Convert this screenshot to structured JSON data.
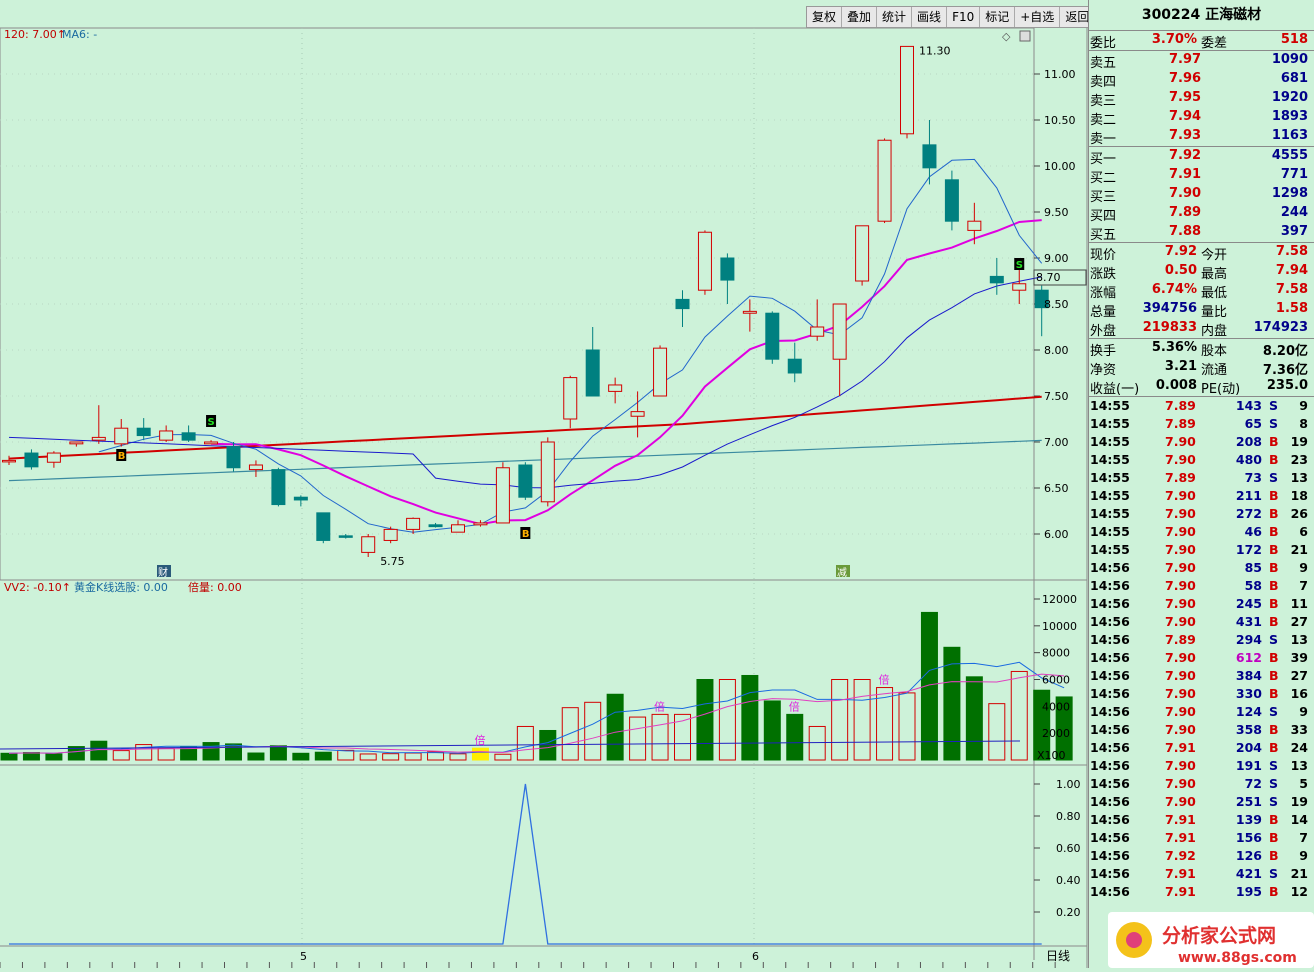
{
  "toolbar": {
    "buttons": [
      "复权",
      "叠加",
      "统计",
      "画线",
      "F10",
      "标记",
      "+自选",
      "返回"
    ]
  },
  "main_chart": {
    "indicator_header": [
      "120: 7.00↑",
      "MA6: -"
    ],
    "y_ticks": [
      "11.00",
      "10.50",
      "10.00",
      "9.50",
      "9.00",
      "8.50",
      "8.00",
      "7.50",
      "7.00",
      "6.50",
      "6.00"
    ],
    "high_label": "11.30",
    "low_label": "5.75",
    "price_tag": "8.70",
    "markers": {
      "cai": "财",
      "jian": "减",
      "buy": "B",
      "sell": "S"
    }
  },
  "volume_chart": {
    "header": [
      "VV2: -0.10↑",
      "黄金K线选股: 0.00",
      "倍量: 0.00"
    ],
    "y_ticks": [
      "12000",
      "10000",
      "8000",
      "6000",
      "4000",
      "2000"
    ],
    "unit": "X100",
    "bei_label": "倍"
  },
  "signal_chart": {
    "y_ticks": [
      "1.00",
      "0.80",
      "0.60",
      "0.40",
      "0.20"
    ],
    "period": "日线",
    "x_labels": [
      "5",
      "6"
    ]
  },
  "colors": {
    "background": "#cdf2d9",
    "up": "#d40000",
    "down": "#008080",
    "volume_down": "#007000",
    "ma_magenta": "#e000e0",
    "ma_red": "#d00000",
    "ma_blue": "#1a1acc",
    "ma_teal": "#3a8aa0",
    "signal_line": "#3070e0"
  },
  "quote": {
    "title": "300224 正海磁材",
    "weibi": {
      "label": "委比",
      "value": "3.70%",
      "label2": "委差",
      "value2": "518"
    },
    "sell": [
      {
        "label": "卖五",
        "price": "7.97",
        "vol": "1090"
      },
      {
        "label": "卖四",
        "price": "7.96",
        "vol": "681"
      },
      {
        "label": "卖三",
        "price": "7.95",
        "vol": "1920"
      },
      {
        "label": "卖二",
        "price": "7.94",
        "vol": "1893"
      },
      {
        "label": "卖一",
        "price": "7.93",
        "vol": "1163"
      }
    ],
    "buy": [
      {
        "label": "买一",
        "price": "7.92",
        "vol": "4555"
      },
      {
        "label": "买二",
        "price": "7.91",
        "vol": "771"
      },
      {
        "label": "买三",
        "price": "7.90",
        "vol": "1298"
      },
      {
        "label": "买四",
        "price": "7.89",
        "vol": "244"
      },
      {
        "label": "买五",
        "price": "7.88",
        "vol": "397"
      }
    ],
    "stats": [
      {
        "l1": "现价",
        "v1": "7.92",
        "l2": "今开",
        "v2": "7.58"
      },
      {
        "l1": "涨跌",
        "v1": "0.50",
        "l2": "最高",
        "v2": "7.94"
      },
      {
        "l1": "涨幅",
        "v1": "6.74%",
        "l2": "最低",
        "v2": "7.58"
      },
      {
        "l1": "总量",
        "v1": "394756",
        "l2": "量比",
        "v2": "1.58"
      },
      {
        "l1": "外盘",
        "v1": "219833",
        "l2": "内盘",
        "v2": "174923"
      }
    ],
    "stats2": [
      {
        "l1": "换手",
        "v1": "5.36%",
        "l2": "股本",
        "v2": "8.20亿"
      },
      {
        "l1": "净资",
        "v1": "3.21",
        "l2": "流通",
        "v2": "7.36亿"
      },
      {
        "l1": "收益(一)",
        "v1": "0.008",
        "l2": "PE(动)",
        "v2": "235.0"
      }
    ]
  },
  "trades": [
    {
      "t": "14:55",
      "p": "7.89",
      "v": "143",
      "bs": "S",
      "n": "9"
    },
    {
      "t": "14:55",
      "p": "7.89",
      "v": "65",
      "bs": "S",
      "n": "8"
    },
    {
      "t": "14:55",
      "p": "7.90",
      "v": "208",
      "bs": "B",
      "n": "19"
    },
    {
      "t": "14:55",
      "p": "7.90",
      "v": "480",
      "bs": "B",
      "n": "23"
    },
    {
      "t": "14:55",
      "p": "7.89",
      "v": "73",
      "bs": "S",
      "n": "13"
    },
    {
      "t": "14:55",
      "p": "7.90",
      "v": "211",
      "bs": "B",
      "n": "18"
    },
    {
      "t": "14:55",
      "p": "7.90",
      "v": "272",
      "bs": "B",
      "n": "26"
    },
    {
      "t": "14:55",
      "p": "7.90",
      "v": "46",
      "bs": "B",
      "n": "6"
    },
    {
      "t": "14:55",
      "p": "7.90",
      "v": "172",
      "bs": "B",
      "n": "21"
    },
    {
      "t": "14:56",
      "p": "7.90",
      "v": "85",
      "bs": "B",
      "n": "9"
    },
    {
      "t": "14:56",
      "p": "7.90",
      "v": "58",
      "bs": "B",
      "n": "7"
    },
    {
      "t": "14:56",
      "p": "7.90",
      "v": "245",
      "bs": "B",
      "n": "11"
    },
    {
      "t": "14:56",
      "p": "7.90",
      "v": "431",
      "bs": "B",
      "n": "27"
    },
    {
      "t": "14:56",
      "p": "7.89",
      "v": "294",
      "bs": "S",
      "n": "13"
    },
    {
      "t": "14:56",
      "p": "7.90",
      "v": "612",
      "bs": "B",
      "n": "39"
    },
    {
      "t": "14:56",
      "p": "7.90",
      "v": "384",
      "bs": "B",
      "n": "27"
    },
    {
      "t": "14:56",
      "p": "7.90",
      "v": "330",
      "bs": "B",
      "n": "16"
    },
    {
      "t": "14:56",
      "p": "7.90",
      "v": "124",
      "bs": "S",
      "n": "9"
    },
    {
      "t": "14:56",
      "p": "7.90",
      "v": "358",
      "bs": "B",
      "n": "33"
    },
    {
      "t": "14:56",
      "p": "7.91",
      "v": "204",
      "bs": "B",
      "n": "24"
    },
    {
      "t": "14:56",
      "p": "7.90",
      "v": "191",
      "bs": "S",
      "n": "13"
    },
    {
      "t": "14:56",
      "p": "7.90",
      "v": "72",
      "bs": "S",
      "n": "5"
    },
    {
      "t": "14:56",
      "p": "7.90",
      "v": "251",
      "bs": "S",
      "n": "19"
    },
    {
      "t": "14:56",
      "p": "7.91",
      "v": "139",
      "bs": "B",
      "n": "14"
    },
    {
      "t": "14:56",
      "p": "7.91",
      "v": "156",
      "bs": "B",
      "n": "7"
    },
    {
      "t": "14:56",
      "p": "7.92",
      "v": "126",
      "bs": "B",
      "n": "9"
    },
    {
      "t": "14:56",
      "p": "7.91",
      "v": "421",
      "bs": "S",
      "n": "21"
    },
    {
      "t": "14:56",
      "p": "7.91",
      "v": "195",
      "bs": "B",
      "n": "12"
    }
  ],
  "watermark": {
    "name": "分析家公式网",
    "url": "www.88gs.com"
  },
  "chart_data": {
    "type": "candlestick",
    "candles": [
      {
        "o": 6.8,
        "h": 6.85,
        "l": 6.75,
        "c": 6.8
      },
      {
        "o": 6.88,
        "h": 6.92,
        "l": 6.7,
        "c": 6.73
      },
      {
        "o": 6.78,
        "h": 6.9,
        "l": 6.72,
        "c": 6.88
      },
      {
        "o": 6.98,
        "h": 7.0,
        "l": 6.95,
        "c": 7.0
      },
      {
        "o": 7.02,
        "h": 7.4,
        "l": 6.98,
        "c": 7.05
      },
      {
        "o": 6.98,
        "h": 7.25,
        "l": 6.95,
        "c": 7.15
      },
      {
        "o": 7.15,
        "h": 7.26,
        "l": 7.02,
        "c": 7.07
      },
      {
        "o": 7.02,
        "h": 7.18,
        "l": 7.0,
        "c": 7.12
      },
      {
        "o": 7.1,
        "h": 7.18,
        "l": 7.0,
        "c": 7.02
      },
      {
        "o": 6.98,
        "h": 7.02,
        "l": 6.98,
        "c": 7.0
      },
      {
        "o": 6.95,
        "h": 7.0,
        "l": 6.68,
        "c": 6.72
      },
      {
        "o": 6.7,
        "h": 6.8,
        "l": 6.62,
        "c": 6.75
      },
      {
        "o": 6.7,
        "h": 6.72,
        "l": 6.3,
        "c": 6.32
      },
      {
        "o": 6.4,
        "h": 6.42,
        "l": 6.3,
        "c": 6.37
      },
      {
        "o": 6.23,
        "h": 6.23,
        "l": 5.9,
        "c": 5.93
      },
      {
        "o": 5.98,
        "h": 6.0,
        "l": 5.95,
        "c": 5.97
      },
      {
        "o": 5.8,
        "h": 6.0,
        "l": 5.75,
        "c": 5.97
      },
      {
        "o": 5.93,
        "h": 6.08,
        "l": 5.9,
        "c": 6.05
      },
      {
        "o": 6.05,
        "h": 6.18,
        "l": 6.0,
        "c": 6.17
      },
      {
        "o": 6.1,
        "h": 6.12,
        "l": 6.07,
        "c": 6.08
      },
      {
        "o": 6.02,
        "h": 6.15,
        "l": 6.02,
        "c": 6.1
      },
      {
        "o": 6.1,
        "h": 6.15,
        "l": 6.08,
        "c": 6.12
      },
      {
        "o": 6.12,
        "h": 6.78,
        "l": 6.12,
        "c": 6.72
      },
      {
        "o": 6.75,
        "h": 6.78,
        "l": 6.37,
        "c": 6.4
      },
      {
        "o": 6.35,
        "h": 7.05,
        "l": 6.3,
        "c": 7.0
      },
      {
        "o": 7.25,
        "h": 7.72,
        "l": 7.15,
        "c": 7.7
      },
      {
        "o": 8.0,
        "h": 8.25,
        "l": 7.5,
        "c": 7.5
      },
      {
        "o": 7.55,
        "h": 7.7,
        "l": 7.42,
        "c": 7.62
      },
      {
        "o": 7.28,
        "h": 7.55,
        "l": 7.05,
        "c": 7.33
      },
      {
        "o": 7.5,
        "h": 8.05,
        "l": 7.5,
        "c": 8.02
      },
      {
        "o": 8.55,
        "h": 8.65,
        "l": 8.25,
        "c": 8.45
      },
      {
        "o": 8.65,
        "h": 9.3,
        "l": 8.6,
        "c": 9.28
      },
      {
        "o": 9.0,
        "h": 9.05,
        "l": 8.5,
        "c": 8.76
      },
      {
        "o": 8.4,
        "h": 8.55,
        "l": 8.2,
        "c": 8.42
      },
      {
        "o": 8.4,
        "h": 8.42,
        "l": 7.85,
        "c": 7.9
      },
      {
        "o": 7.9,
        "h": 8.08,
        "l": 7.65,
        "c": 7.75
      },
      {
        "o": 8.15,
        "h": 8.55,
        "l": 8.1,
        "c": 8.25
      },
      {
        "o": 7.9,
        "h": 8.5,
        "l": 7.5,
        "c": 8.5
      },
      {
        "o": 8.75,
        "h": 9.35,
        "l": 8.7,
        "c": 9.35
      },
      {
        "o": 9.4,
        "h": 10.3,
        "l": 9.38,
        "c": 10.28
      },
      {
        "o": 10.35,
        "h": 11.3,
        "l": 10.3,
        "c": 11.3
      },
      {
        "o": 10.23,
        "h": 10.5,
        "l": 9.8,
        "c": 9.98
      },
      {
        "o": 9.85,
        "h": 9.95,
        "l": 9.3,
        "c": 9.4
      },
      {
        "o": 9.3,
        "h": 9.6,
        "l": 9.15,
        "c": 9.4
      },
      {
        "o": 8.8,
        "h": 9.0,
        "l": 8.6,
        "c": 8.73
      },
      {
        "o": 8.65,
        "h": 9.0,
        "l": 8.5,
        "c": 8.72
      },
      {
        "o": 8.65,
        "h": 8.7,
        "l": 8.15,
        "c": 8.46
      }
    ],
    "volume": [
      500,
      560,
      450,
      1000,
      1400,
      700,
      1150,
      900,
      1000,
      1300,
      1200,
      520,
      1060,
      500,
      580,
      720,
      450,
      470,
      520,
      600,
      460,
      880,
      430,
      2500,
      2200,
      3900,
      4300,
      4900,
      3200,
      3400,
      3400,
      6000,
      6000,
      6300,
      4400,
      3400,
      2500,
      6000,
      6000,
      5400,
      5000,
      11000,
      8400,
      6200,
      4200,
      6600,
      5200,
      4700
    ],
    "vol_rising": [
      false,
      false,
      false,
      false,
      false,
      true,
      true,
      true,
      false,
      false,
      false,
      false,
      false,
      false,
      false,
      true,
      true,
      true,
      true,
      true,
      true,
      true,
      true,
      true,
      false,
      true,
      true,
      false,
      true,
      true,
      true,
      false,
      true,
      false,
      false,
      false,
      true,
      true,
      true,
      true,
      true,
      false,
      false,
      false,
      true,
      true,
      false
    ],
    "signal": {
      "peak_index": 23,
      "peak_value": 1.0
    },
    "y_range": [
      5.6,
      11.5
    ]
  }
}
